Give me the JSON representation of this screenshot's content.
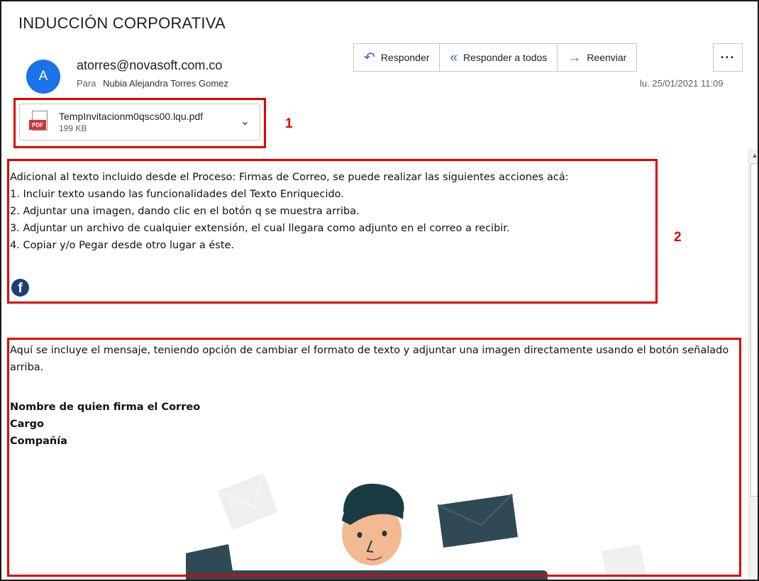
{
  "email": {
    "subject": "INDUCCIÓN CORPORATIVA",
    "avatar_initial": "A",
    "sender": "atorres@novasoft.com.co",
    "to_label": "Para",
    "to_name": "Nubia Alejandra Torres Gomez",
    "date": "lu. 25/01/2021 11:09"
  },
  "actions": {
    "reply": "Responder",
    "reply_all": "Responder a todos",
    "forward": "Reenviar",
    "more": "···"
  },
  "attachment": {
    "icon_label": "PDF",
    "name": "TempInvitacionm0qscs00.lqu.pdf",
    "size": "199 KB"
  },
  "markers": {
    "one": "1",
    "two": "2"
  },
  "body": {
    "intro": "Adicional al texto incluido desde el Proceso: Firmas de Correo, se puede realizar las siguientes acciones acá:",
    "items": [
      "1. Incluir texto usando las funcionalidades del Texto Enriquecido.",
      "2. Adjuntar una imagen, dando clic en el botón q se muestra arriba.",
      "3. Adjuntar un archivo de cualquier extensión, el cual llegara como adjunto en el correo a recibir.",
      "4. Copiar y/o Pegar desde otro lugar a éste."
    ],
    "facebook_glyph": "f",
    "message": "Aquí se incluye el mensaje, teniendo opción de cambiar el formato de texto y adjuntar una imagen directamente usando el botón señalado arriba.",
    "signature": {
      "name": "Nombre de quien firma el Correo",
      "title": "Cargo",
      "company": "Compañía"
    }
  },
  "colors": {
    "highlight": "#e00000",
    "accent": "#2b6cc4",
    "avatar": "#1a73e8",
    "pdf": "#d13438"
  },
  "icons": [
    "reply-icon",
    "reply-all-icon",
    "forward-icon",
    "more-icon",
    "pdf-file-icon",
    "chevron-down-icon",
    "facebook-icon",
    "scroll-up-icon"
  ]
}
